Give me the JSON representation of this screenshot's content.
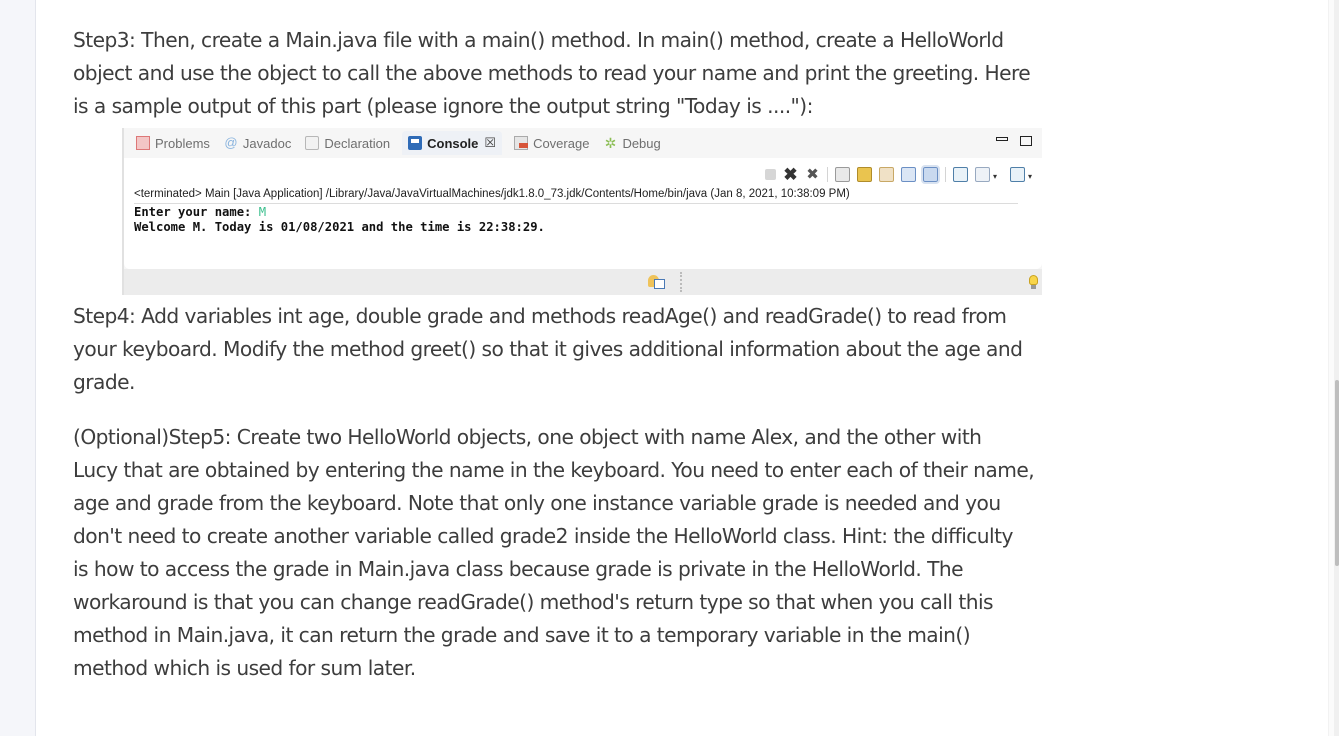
{
  "document": {
    "step3": {
      "lines": [
        "Step3: Then, create a Main.java file with a main() method. In main() method, create a HelloWorld",
        "object and use the object to call the above methods to read your name and print the greeting. Here",
        "is a sample output of this part (please ignore the output string \"Today is ....\"):"
      ]
    },
    "console_screenshot": {
      "tabs": [
        {
          "label": "Problems",
          "icon": "problems-icon",
          "active": false
        },
        {
          "label": "Javadoc",
          "icon": "at-icon",
          "active": false
        },
        {
          "label": "Declaration",
          "icon": "declaration-icon",
          "active": false
        },
        {
          "label": "Console",
          "icon": "console-icon",
          "active": true,
          "close": "☒"
        },
        {
          "label": "Coverage",
          "icon": "coverage-icon",
          "active": false
        },
        {
          "label": "Debug",
          "icon": "debug-icon",
          "active": false
        }
      ],
      "toolbar_icons": [
        "terminate-icon",
        "remove-launch-icon",
        "remove-all-terminated-icon",
        "clear-console-icon",
        "scroll-lock-icon",
        "word-wrap-icon",
        "show-on-output-icon",
        "show-on-error-icon",
        "pin-console-icon",
        "display-console-icon",
        "open-console-icon"
      ],
      "terminated_line": "<terminated> Main [Java Application] /Library/Java/JavaVirtualMachines/jdk1.8.0_73.jdk/Contents/Home/bin/java (Jan 8, 2021, 10:38:09 PM)",
      "output": {
        "prompt": "Enter your name: ",
        "input_value": "M",
        "result": "Welcome M. Today is 01/08/2021 and the time is 22:38:29."
      }
    },
    "step4": {
      "lines": [
        "Step4: Add variables int age, double grade and methods readAge() and readGrade() to read from",
        "your keyboard. Modify the method greet() so that it gives additional information about the age and",
        "grade."
      ]
    },
    "step5": {
      "lines": [
        "(Optional)Step5: Create two HelloWorld objects, one object with name Alex, and the other with",
        "Lucy that are obtained by entering the name in the keyboard. You need to enter each of their name,",
        "age and grade from the keyboard. Note that only one instance variable grade is needed and you",
        "don't need to create another variable called grade2 inside the HelloWorld class. Hint: the difficulty",
        "is how to access the grade in Main.java class because grade is private in the HelloWorld. The",
        "workaround is that you can change readGrade() method's return type so that when you call this",
        "method in Main.java, it can return the grade and save it to a temporary variable in the main()",
        "method which is used for sum later."
      ]
    }
  },
  "colors": {
    "text": "#3d3d3d",
    "gutter": "#f5f6fa",
    "console_input": "#3bbf8d",
    "scroll_thumb": "#bdbdbd"
  }
}
